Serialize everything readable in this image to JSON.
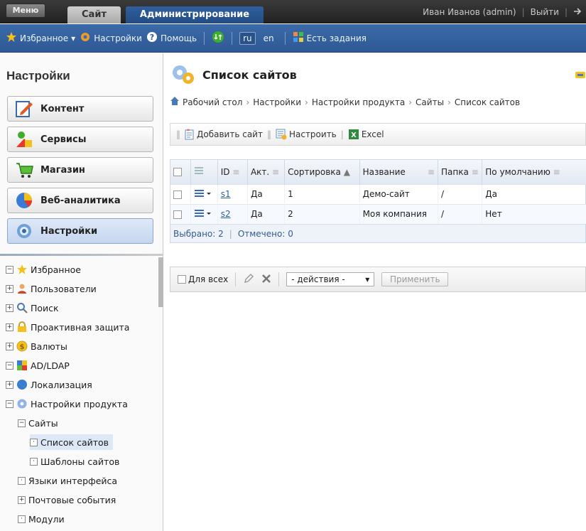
{
  "topbar": {
    "menu_label": "Меню",
    "tab_site": "Сайт",
    "tab_admin": "Администрирование",
    "user": "Иван Иванов (admin)",
    "logout": "Выйти"
  },
  "toolbar": {
    "favorites": "Избранное",
    "settings": "Настройки",
    "help": "Помощь",
    "lang_ru": "ru",
    "lang_en": "en",
    "tasks": "Есть задания"
  },
  "left": {
    "title": "Настройки",
    "categories": [
      "Контент",
      "Сервисы",
      "Магазин",
      "Веб-аналитика",
      "Настройки"
    ],
    "tree": [
      "Избранное",
      "Пользователи",
      "Поиск",
      "Проактивная защита",
      "Валюты",
      "AD/LDAP",
      "Локализация",
      "Настройки продукта",
      "Сайты",
      "Список сайтов",
      "Шаблоны сайтов",
      "Языки интерфейса",
      "Почтовые события",
      "Модули"
    ]
  },
  "main": {
    "title": "Список сайтов",
    "breadcrumb": [
      "Рабочий стол",
      "Настройки",
      "Настройки продукта",
      "Сайты",
      "Список сайтов"
    ],
    "add_site": "Добавить сайт",
    "configure": "Настроить",
    "excel": "Excel",
    "columns": [
      "ID",
      "Акт.",
      "Сортировка",
      "Название",
      "Папка",
      "По умолчанию"
    ],
    "rows": [
      {
        "id": "s1",
        "active": "Да",
        "sort": "1",
        "name": "Демо-сайт",
        "folder": "/",
        "default": "Да"
      },
      {
        "id": "s2",
        "active": "Да",
        "sort": "2",
        "name": "Моя компания",
        "folder": "/",
        "default": "Нет"
      }
    ],
    "selected": "Выбрано: 2",
    "checked": "Отмечено: 0",
    "for_all": "Для всех",
    "actions": "- действия -",
    "apply": "Применить"
  }
}
